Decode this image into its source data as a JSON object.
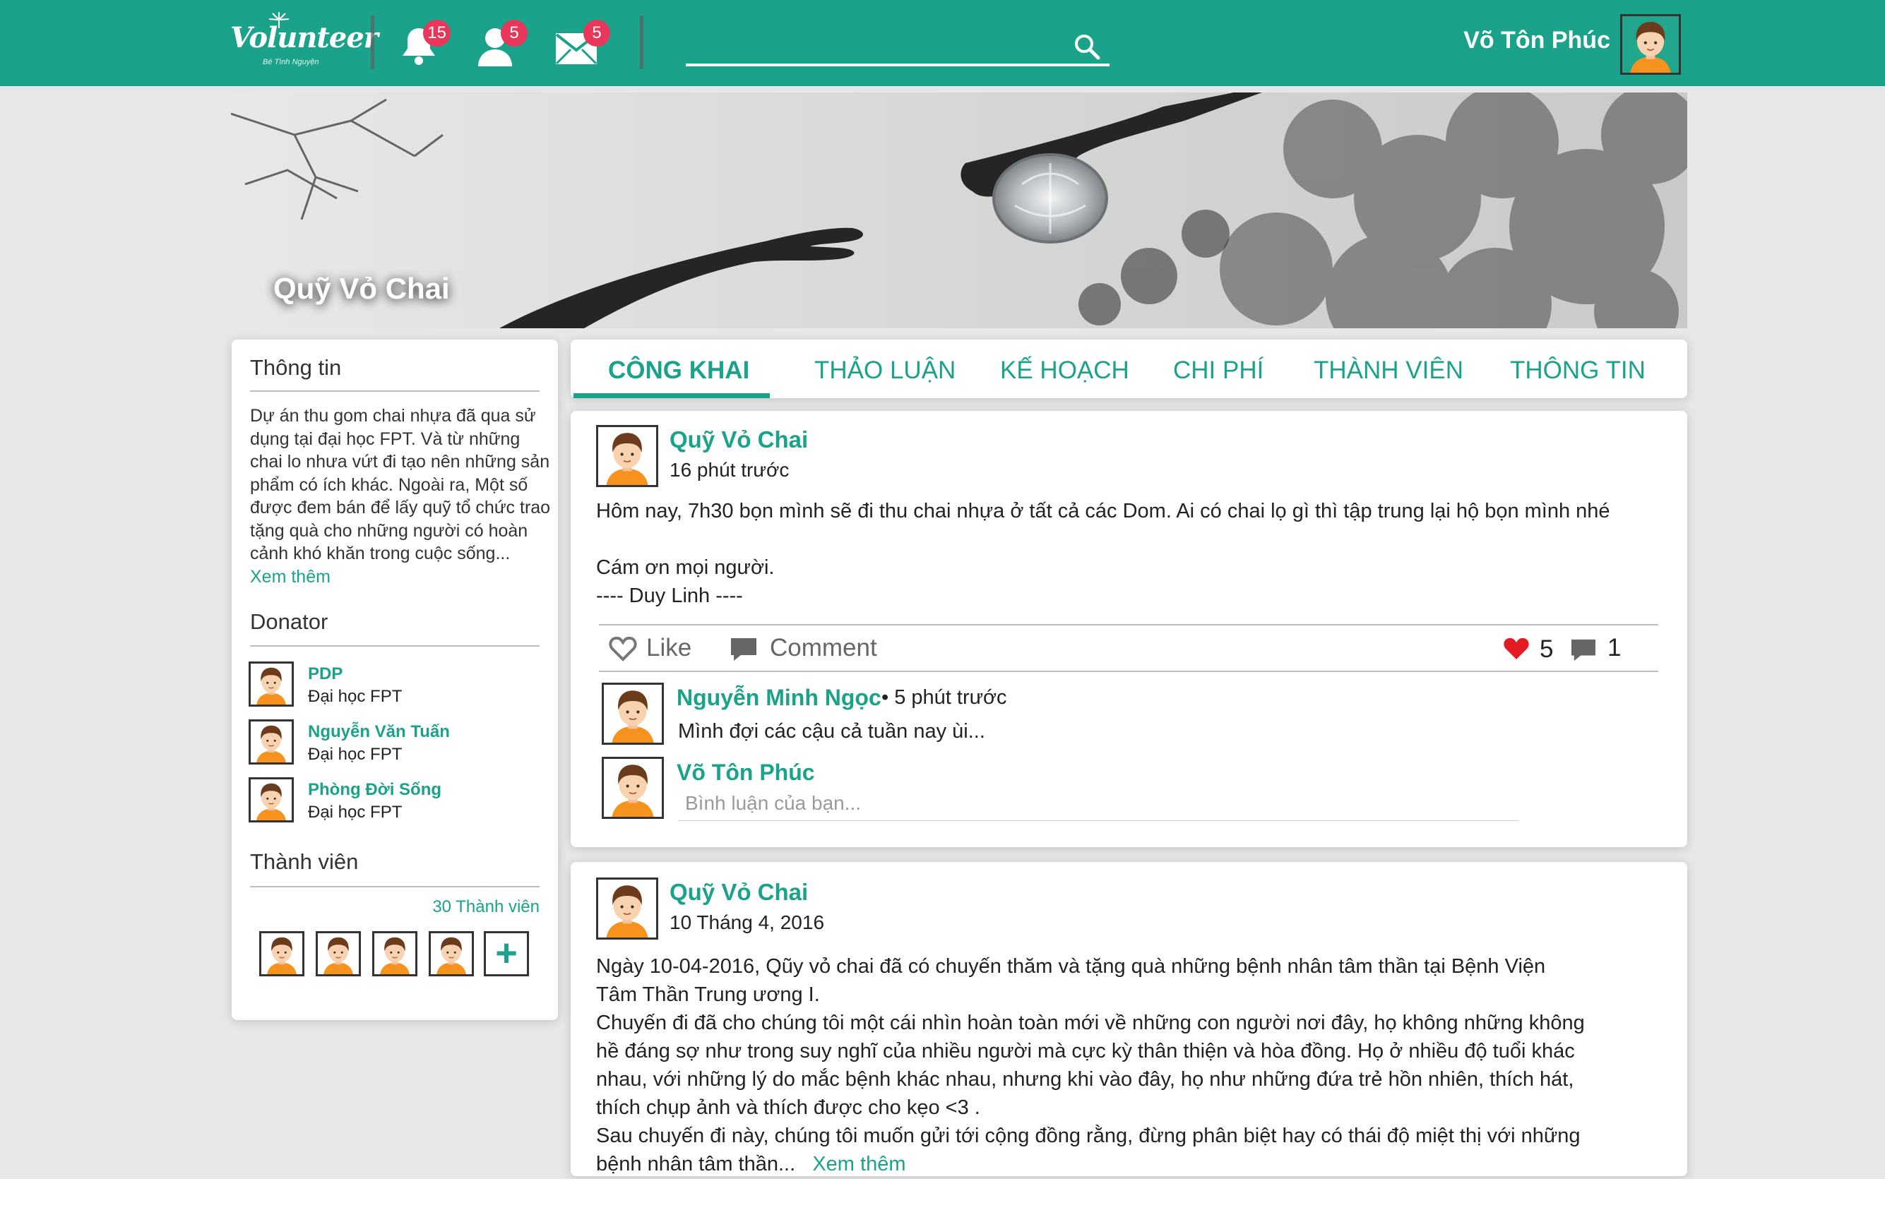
{
  "header": {
    "logo_text": "Volunteer",
    "logo_sub": "Bé Tình Nguyện",
    "notifications_count": "15",
    "friend_requests_count": "5",
    "messages_count": "5",
    "search_placeholder": "",
    "username": "Võ Tôn Phúc",
    "brand_color": "#1ba28a"
  },
  "cover": {
    "title": "Quỹ Vỏ Chai"
  },
  "sidebar": {
    "info_title": "Thông tin",
    "info_text": "Dự án thu gom chai nhựa đã qua sử dụng tại đại học FPT.  Và từ những chai lo nhưa vứt đi tạo nên những sản phẩm có ích khác. Ngoài ra, Một số được  đem bán để lấy quỹ tổ chức trao tặng quà cho những người có hoàn cảnh khó khăn trong cuộc sống...",
    "info_more": "Xem thêm",
    "donator_title": "Donator",
    "donators": [
      {
        "name": "PDP",
        "org": "Đại học FPT"
      },
      {
        "name": "Nguyễn Văn Tuấn",
        "org": "Đại học FPT"
      },
      {
        "name": "Phòng Đời Sống",
        "org": "Đại học FPT"
      }
    ],
    "members_title": "Thành viên",
    "members_count": "30 Thành viên",
    "add_member": "+"
  },
  "tabs": [
    {
      "label": "CÔNG KHAI",
      "active": true
    },
    {
      "label": "THẢO LUẬN"
    },
    {
      "label": "KẾ HOẠCH"
    },
    {
      "label": "CHI PHÍ"
    },
    {
      "label": "THÀNH VIÊN"
    },
    {
      "label": "THÔNG TIN"
    }
  ],
  "posts": [
    {
      "author": "Quỹ Vỏ Chai",
      "time": "16 phút trước",
      "lines": [
        "Hôm nay, 7h30 bọn mình sẽ đi thu chai nhựa ở tất cả các Dom. Ai có chai lọ gì thì tập trung lại hộ bọn mình nhé",
        "Cám ơn mọi người.",
        "---- Duy Linh ----"
      ],
      "like_label": "Like",
      "comment_label": "Comment",
      "likes_count": "5",
      "comments_count": "1",
      "comments": [
        {
          "author": "Nguyễn Minh Ngọc",
          "time": "• 5 phút trước",
          "text": "Mình đợi các cậu cả tuần nay ùi..."
        }
      ],
      "reply_author": "Võ Tôn Phúc",
      "reply_placeholder": "Bình luận của bạn..."
    },
    {
      "author": "Quỹ Vỏ Chai",
      "time": "10  Tháng 4, 2016",
      "lines": [
        "Ngày 10-04-2016, Qũy vỏ chai đã có chuyến thăm và tặng quà những bệnh nhân tâm thần tại Bệnh Viện",
        "Tâm Thần Trung ương I.",
        "Chuyến đi đã cho chúng tôi một cái nhìn hoàn toàn mới về những con người nơi đây, họ không những không",
        "hề đáng sợ như trong suy nghĩ của nhiều người mà cực kỳ thân thiện và hòa đồng. Họ ở nhiều độ tuổi khác",
        "nhau, với những lý do mắc bệnh khác nhau, nhưng khi vào đây, họ như những đứa trẻ hồn nhiên, thích hát,",
        "thích chụp ảnh và thích được cho kẹo <3 .",
        "Sau chuyến đi này, chúng tôi muốn gửi tới cộng đồng rằng, đừng phân biệt hay có thái độ miệt thị với những",
        "bệnh nhân tâm thần..."
      ],
      "more": "Xem thêm"
    }
  ]
}
